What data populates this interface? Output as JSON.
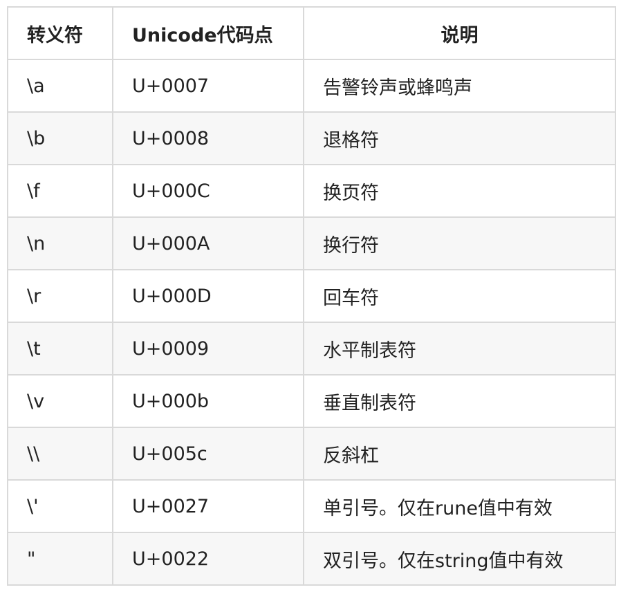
{
  "table": {
    "headers": [
      "转义符",
      "Unicode代码点",
      "说明"
    ],
    "rows": [
      [
        "\\a",
        "U+0007",
        "告警铃声或蜂鸣声"
      ],
      [
        "\\b",
        "U+0008",
        "退格符"
      ],
      [
        "\\f",
        "U+000C",
        "换页符"
      ],
      [
        "\\n",
        "U+000A",
        "换行符"
      ],
      [
        "\\r",
        "U+000D",
        "回车符"
      ],
      [
        "\\t",
        "U+0009",
        "水平制表符"
      ],
      [
        "\\v",
        "U+000b",
        "垂直制表符"
      ],
      [
        "\\\\",
        "U+005c",
        "反斜杠"
      ],
      [
        "\\'",
        "U+0027",
        "单引号。仅在rune值中有效"
      ],
      [
        "\"",
        "U+0022",
        "双引号。仅在string值中有效"
      ]
    ]
  }
}
